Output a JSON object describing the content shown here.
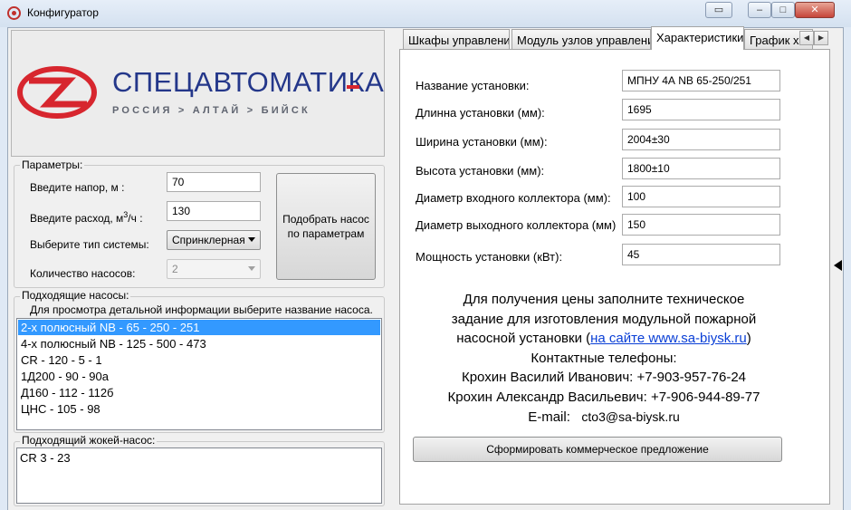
{
  "window": {
    "title": "Конфигуратор",
    "close_glyph": "✕",
    "minimize_glyph": "–",
    "maximize_glyph": "□",
    "extra_glyph": "▭"
  },
  "logo": {
    "main_text": "СПЕЦАВТОМАТИКА",
    "sub_text": "РОССИЯ > АЛТАЙ > БИЙСК",
    "brand_red": "#d7262e",
    "brand_blue": "#24378a"
  },
  "params": {
    "legend": "Параметры:",
    "head_label": "Введите напор, м :",
    "head_value": "70",
    "flow_label_prefix": "Введите расход, м",
    "flow_label_sup": "3",
    "flow_label_suffix": "/ч :",
    "flow_value": "130",
    "system_type_label": "Выберите тип системы:",
    "system_type_value": "Спринклерная",
    "pump_count_label": "Количество насосов:",
    "pump_count_value": "2",
    "pick_button_label": "Подобрать насос по параметрам"
  },
  "pumps": {
    "legend": "Подходящие насосы:",
    "hint": "Для просмотра детальной информации выберите название насоса.",
    "items": [
      "2-х полюсный NB - 65 - 250 - 251",
      "4-х полюсный NB - 125 - 500 - 473",
      "CR - 120 - 5 - 1",
      "1Д200 - 90 - 90а",
      "Д160 - 112 - 112б",
      "ЦНС - 105 - 98"
    ],
    "selected_index": 0
  },
  "jockey": {
    "legend": "Подходящий жокей-насос:",
    "value": "CR 3 - 23"
  },
  "tabs": [
    {
      "label": "Шкафы управления",
      "active": false
    },
    {
      "label": "Модуль узлов управления",
      "active": false
    },
    {
      "label": "Характеристики",
      "active": true
    },
    {
      "label": "График ха",
      "active": false
    }
  ],
  "tab_scroll": {
    "left": "◀",
    "right": "▶"
  },
  "characteristics": {
    "fields": [
      {
        "label": "Название установки:",
        "value": "МПНУ 4А NB 65-250/251"
      },
      {
        "label": "Длинна установки (мм):",
        "value": "1695"
      },
      {
        "label": "Ширина установки (мм):",
        "value": "2004±30"
      },
      {
        "label": "Высота установки (мм):",
        "value": "1800±10"
      },
      {
        "label": "Диаметр входного коллектора (мм):",
        "value": "100"
      },
      {
        "label": "Диаметр выходного коллектора (мм)",
        "value": "150"
      },
      {
        "label": "Мощность установки (кВт):",
        "value": "45"
      }
    ],
    "info": {
      "line1": "Для получения цены заполните техническое",
      "line2": "задание для изготовления модульной пожарной",
      "line3_prefix": "насосной установки (",
      "line3_link": "на сайте www.sa-biysk.ru",
      "line3_suffix": ")",
      "line4": "Контактные телефоны:",
      "line5": "Крохин Василий Иванович: +7-903-957-76-24",
      "line6": "Крохин Александр Васильевич: +7-906-944-89-77",
      "email_label": "E-mail:",
      "email_value": "cto3@sa-biysk.ru"
    },
    "offer_button_label": "Сформировать коммерческое предложение"
  }
}
